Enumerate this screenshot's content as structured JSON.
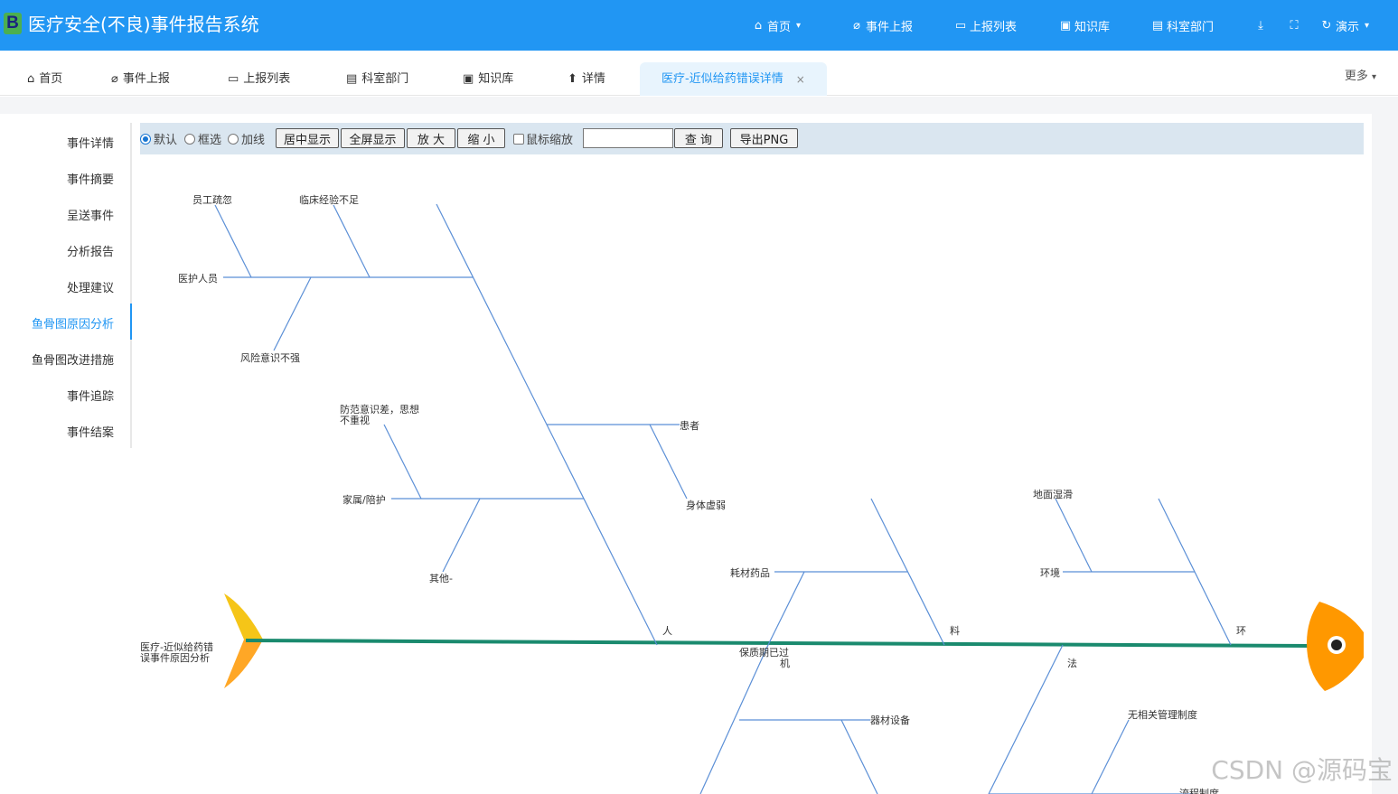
{
  "header": {
    "logo_letter": "B",
    "title": "医疗安全(不良)事件报告系统",
    "nav": {
      "home": "首页",
      "report": "事件上报",
      "list": "上报列表",
      "kb": "知识库",
      "dept": "科室部门",
      "user": "演示"
    }
  },
  "tabs": {
    "home": "首页",
    "report": "事件上报",
    "list": "上报列表",
    "dept": "科室部门",
    "kb": "知识库",
    "detail": "详情",
    "active": "医疗-近似给药错误详情",
    "more": "更多"
  },
  "sidemenu": {
    "items": [
      "事件详情",
      "事件摘要",
      "呈送事件",
      "分析报告",
      "处理建议",
      "鱼骨图原因分析",
      "鱼骨图改进措施",
      "事件追踪",
      "事件结案"
    ]
  },
  "toolbar": {
    "mode_default": "默认",
    "mode_select": "框选",
    "mode_addline": "加线",
    "center_btn": "居中显示",
    "fullscreen_btn": "全屏显示",
    "zoom_in_btn": "放 大",
    "zoom_out_btn": "缩 小",
    "wheel_zoom": "鼠标缩放",
    "search_value": "",
    "search_btn": "查 询",
    "export_btn": "导出PNG"
  },
  "fishbone": {
    "tail_label_1": "医疗-近似给药错",
    "tail_label_2": "误事件原因分析",
    "main_ren": "人",
    "main_liao": "料",
    "main_huan": "环",
    "main_fa": "法",
    "main_ji_1": "保质期已过",
    "main_ji_2": "机",
    "b_huhu": "医护人员",
    "b_huhu_1": "员工疏忽",
    "b_huhu_2": "临床经验不足",
    "b_huhu_3": "风险意识不强",
    "b_patient": "患者",
    "b_patient_1": "身体虚弱",
    "b_family": "家属/陪护",
    "b_family_1a": "防范意识差，思想",
    "b_family_1b": "不重视",
    "b_family_2": "其他-",
    "b_material": "耗材药品",
    "b_env": "环境",
    "b_env_1": "地面湿滑",
    "b_equipment": "器材设备",
    "b_rule_1": "无相关管理制度",
    "b_rule_2": "流程制度"
  },
  "watermark": "CSDN @源码宝",
  "colors": {
    "header_bg": "#2196f3",
    "accent": "#2196f3",
    "spine": "#1a8a6e",
    "bone": "#5b8fd6",
    "head": "#ff9800",
    "tail": "#f5c518"
  }
}
